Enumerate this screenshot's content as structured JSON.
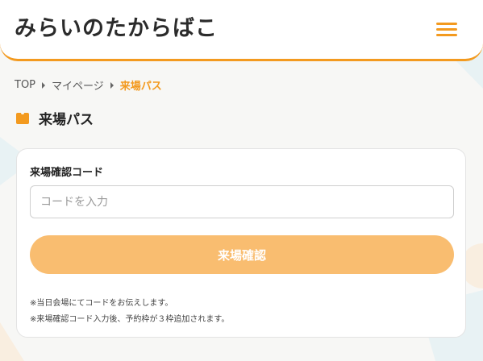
{
  "header": {
    "logo_text": "みらいのたからばこ",
    "menu_icon": "hamburger-menu-icon",
    "accent_color": "#f39a1f"
  },
  "breadcrumb": {
    "items": [
      "TOP",
      "マイページ",
      "来場パス"
    ]
  },
  "page": {
    "title": "来場パス",
    "title_icon": "ticket-icon"
  },
  "form": {
    "label": "来場確認コード",
    "input_value": "",
    "input_placeholder": "コードを入力",
    "submit_label": "来場確認",
    "button_color": "#f9bd70"
  },
  "notes": [
    "※当日会場にてコードをお伝えします。",
    "※来場確認コード入力後、予約枠が３枠追加されます。"
  ]
}
